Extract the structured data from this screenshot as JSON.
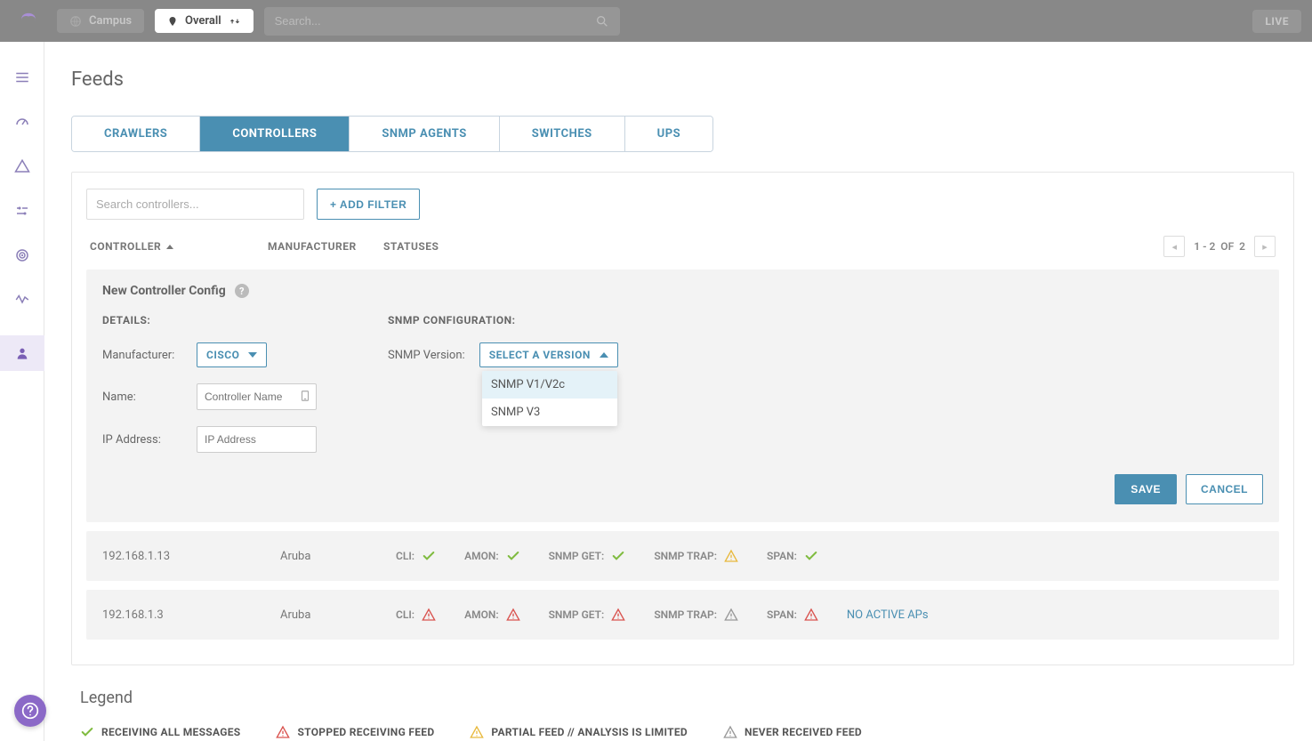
{
  "topbar": {
    "campus": "Campus",
    "overall": "Overall",
    "search_placeholder": "Search...",
    "live": "LIVE"
  },
  "page_title": "Feeds",
  "tabs": [
    "CRAWLERS",
    "CONTROLLERS",
    "SNMP AGENTS",
    "SWITCHES",
    "UPS"
  ],
  "active_tab": 1,
  "filters": {
    "search_placeholder": "Search controllers...",
    "add_filter": "+ ADD FILTER"
  },
  "columns": {
    "controller": "CONTROLLER",
    "manufacturer": "MANUFACTURER",
    "statuses": "STATUSES"
  },
  "pagination": {
    "range": "1 - 2",
    "of": "OF",
    "total": "2"
  },
  "config": {
    "title": "New Controller Config",
    "details_label": "DETAILS:",
    "snmp_label": "SNMP CONFIGURATION:",
    "manufacturer_label": "Manufacturer:",
    "manufacturer_value": "CISCO",
    "name_label": "Name:",
    "name_placeholder": "Controller Name",
    "ip_label": "IP Address:",
    "ip_placeholder": "IP Address",
    "snmp_version_label": "SNMP Version:",
    "snmp_version_value": "SELECT A VERSION",
    "snmp_options": [
      "SNMP V1/V2c",
      "SNMP V3"
    ],
    "save": "SAVE",
    "cancel": "CANCEL"
  },
  "rows": [
    {
      "ip": "192.168.1.13",
      "manufacturer": "Aruba",
      "statuses": [
        {
          "label": "CLI:",
          "state": "ok"
        },
        {
          "label": "AMON:",
          "state": "ok"
        },
        {
          "label": "SNMP GET:",
          "state": "ok"
        },
        {
          "label": "SNMP TRAP:",
          "state": "partial"
        },
        {
          "label": "SPAN:",
          "state": "ok"
        }
      ],
      "extra": ""
    },
    {
      "ip": "192.168.1.3",
      "manufacturer": "Aruba",
      "statuses": [
        {
          "label": "CLI:",
          "state": "stopped"
        },
        {
          "label": "AMON:",
          "state": "stopped"
        },
        {
          "label": "SNMP GET:",
          "state": "stopped"
        },
        {
          "label": "SNMP TRAP:",
          "state": "never"
        },
        {
          "label": "SPAN:",
          "state": "stopped"
        }
      ],
      "extra": "NO ACTIVE APs"
    }
  ],
  "legend": {
    "title": "Legend",
    "items": [
      {
        "state": "ok",
        "label": "RECEIVING ALL MESSAGES"
      },
      {
        "state": "stopped",
        "label": "STOPPED RECEIVING FEED"
      },
      {
        "state": "partial",
        "label": "PARTIAL FEED // ANALYSIS IS LIMITED"
      },
      {
        "state": "never",
        "label": "NEVER RECEIVED FEED"
      }
    ]
  },
  "icons": {
    "states": {
      "ok": {
        "glyph": "check",
        "color": "#7fbb3f"
      },
      "stopped": {
        "glyph": "warn",
        "color": "#d9534f"
      },
      "partial": {
        "glyph": "warn",
        "color": "#e8b93d"
      },
      "never": {
        "glyph": "warn",
        "color": "#999"
      }
    }
  }
}
